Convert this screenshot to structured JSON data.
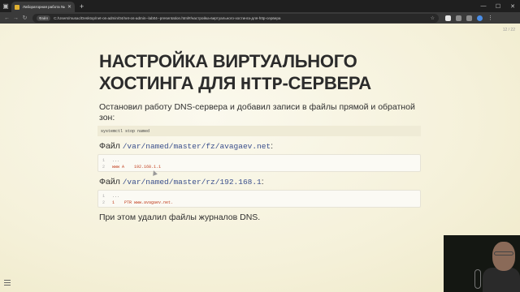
{
  "browser": {
    "tab_title": "Лабораторная работа №4",
    "address_chip": "Файл",
    "url": "C:/Users/musac/Desktop/net-os-admin/04/net-os-admin--lab04--presentation.html#/настройка-виртуального-хостинга-для-http-сервера"
  },
  "slide": {
    "counter": "12 / 22",
    "title_part1": "НАСТРОЙКА ВИРТУАЛЬНОГО ХОСТИНГА ДЛЯ ",
    "title_http": "HTTP",
    "title_part2": "-СЕРВЕРА",
    "intro": "Остановил работу DNS-сервера и добавил записи в файлы прямой и обратной зон:",
    "command": "systemctl stop named",
    "file1_prefix": "Файл ",
    "file1_path": "/var/named/master/fz/avagaev.net",
    "file1_suffix": ":",
    "file1_lines": [
      {
        "num": "1",
        "text": "..."
      },
      {
        "num": "2",
        "text": "www A    192.168.1.1"
      }
    ],
    "file2_prefix": "Файл ",
    "file2_path": "/var/named/master/rz/192.168.1",
    "file2_suffix": ":",
    "file2_lines": [
      {
        "num": "1",
        "text": "..."
      },
      {
        "num": "2",
        "text": "1    PTR www.avagaev.net."
      }
    ],
    "outro": "При этом удалил файлы журналов DNS."
  }
}
